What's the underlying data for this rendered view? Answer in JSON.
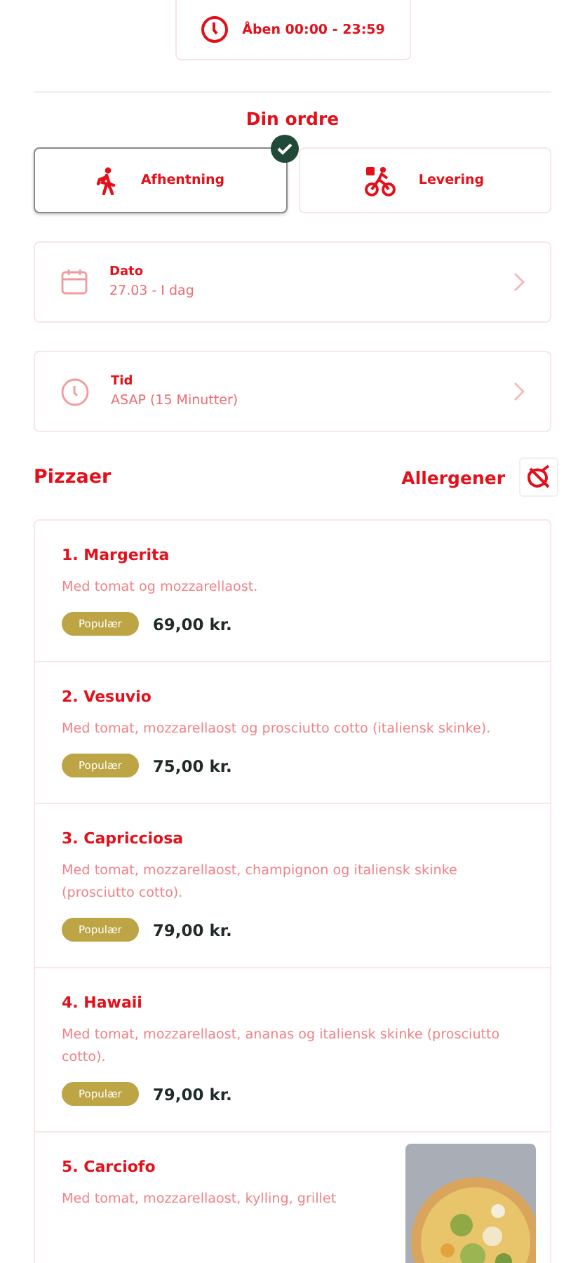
{
  "opening_hours": "Åben 00:00 - 23:59",
  "order": {
    "title": "Din ordre",
    "modes": [
      {
        "kind": "pickup",
        "label": "Afhentning",
        "selected": true
      },
      {
        "kind": "delivery",
        "label": "Levering",
        "selected": false
      }
    ],
    "fields": [
      {
        "kind": "date",
        "label": "Dato",
        "value": "27.03 - I dag"
      },
      {
        "kind": "time",
        "label": "Tid",
        "value": "ASAP (15 Minutter)"
      }
    ]
  },
  "menu": {
    "category": "Pizzaer",
    "allergens_label": "Allergener",
    "items": [
      {
        "name": "1. Margerita",
        "description": "Med tomat og mozzarellaost.",
        "badge": "Populær",
        "price": "69,00 kr."
      },
      {
        "name": "2. Vesuvio",
        "description": "Med tomat, mozzarellaost og prosciutto cotto (italiensk skinke).",
        "badge": "Populær",
        "price": "75,00 kr."
      },
      {
        "name": "3. Capricciosa",
        "description": "Med tomat, mozzarellaost, champignon og italiensk skinke (prosciutto cotto).",
        "badge": "Populær",
        "price": "79,00 kr."
      },
      {
        "name": "4. Hawaii",
        "description": "Med tomat, mozzarellaost, ananas og italiensk skinke (prosciutto cotto).",
        "badge": "Populær",
        "price": "79,00 kr."
      },
      {
        "name": "5. Carciofo",
        "description": "Med tomat, mozzarellaost, kylling, grillet"
      }
    ]
  }
}
